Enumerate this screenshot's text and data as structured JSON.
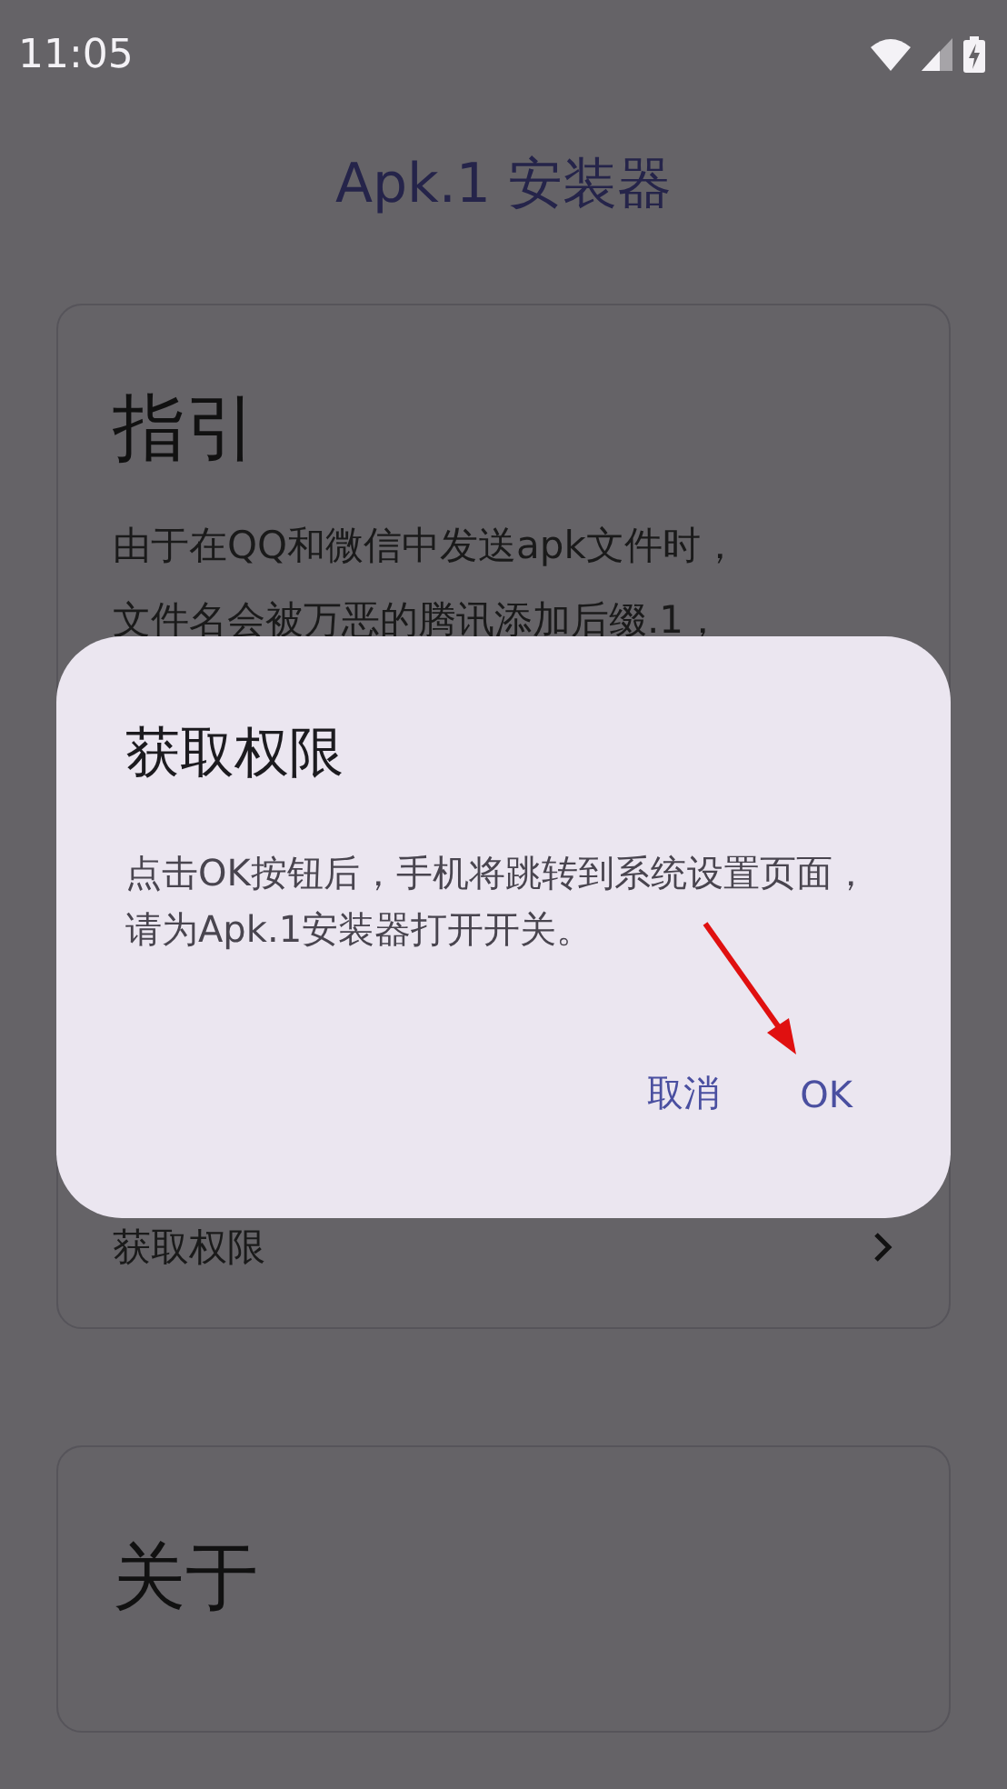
{
  "status_bar": {
    "time": "11:05"
  },
  "app_title": "Apk.1 安装器",
  "guide_card": {
    "title": "指引",
    "lines": [
      "由于在QQ和微信中发送apk文件时，",
      "文件名会被万恶的腾讯添加后缀.1，"
    ],
    "action": {
      "label": "获取权限"
    }
  },
  "about_card": {
    "title": "关于"
  },
  "dialog": {
    "title": "获取权限",
    "message": "点击OK按钮后，手机将跳转到系统设置页面，请为Apk.1安装器打开开关。",
    "buttons": [
      {
        "label": "取消"
      },
      {
        "label": "OK"
      }
    ]
  }
}
